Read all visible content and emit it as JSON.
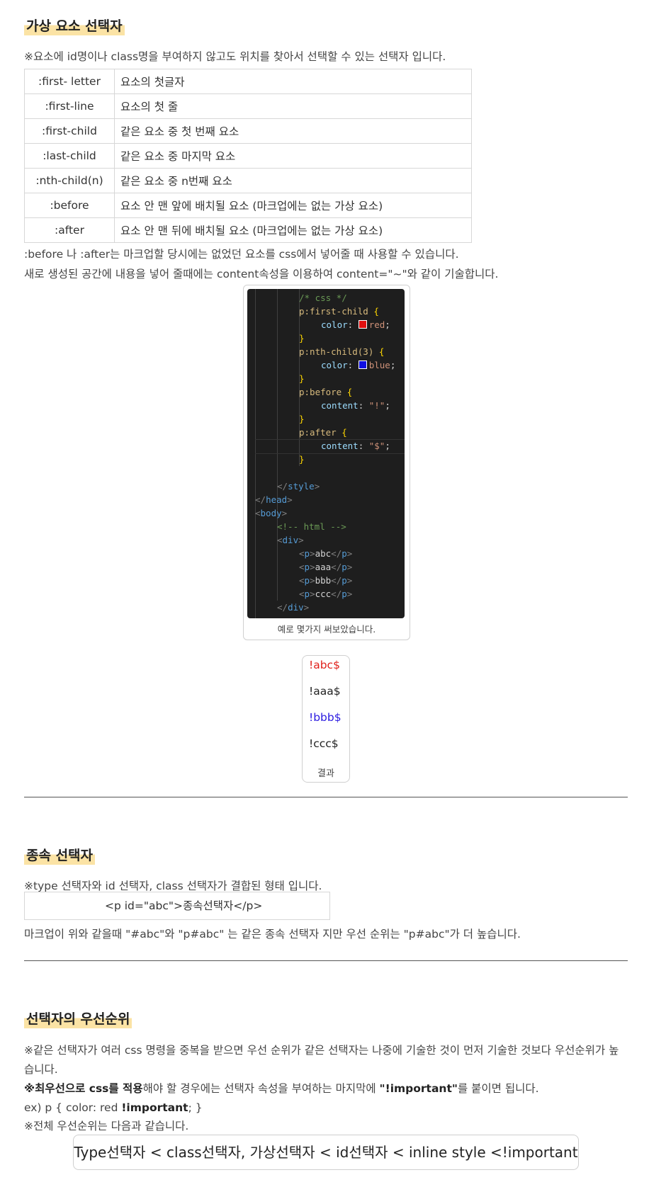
{
  "sections": {
    "pseudo": {
      "title": "가상 요소 선택자",
      "intro": "※요소에 id명이나 class명을 부여하지 않고도 위치를 찾아서 선택할 수 있는 선택자 입니다.",
      "rows": [
        {
          "key": ":first- letter",
          "desc": "요소의 첫글자"
        },
        {
          "key": ":first-line",
          "desc": "요소의 첫 줄"
        },
        {
          "key": ":first-child",
          "desc": "같은 요소 중 첫 번째 요소"
        },
        {
          "key": ":last-child",
          "desc": "같은 요소 중 마지막 요소"
        },
        {
          "key": ":nth-child(n)",
          "desc": "같은 요소 중 n번째 요소"
        },
        {
          "key": ":before",
          "desc": "요소 안 맨 앞에 배치될 요소 (마크업에는 없는 가상 요소)"
        },
        {
          "key": ":after",
          "desc": "요소 안 맨 뒤에 배치될 요소 (마크업에는 없는 가상 요소)"
        }
      ],
      "note1": ":before 나 :after는 마크업할 당시에는 없었던 요소를 css에서 넣어줄 때 사용할 수 있습니다.",
      "note2": "새로 생성된 공간에 내용을 넣어 줄때에는 content속성을 이용하여 content=\"~\"와 같이 기술합니다.",
      "code": {
        "comment_css": "/* css */",
        "sel1": "p:first-child",
        "sel2": "p:nth-child(3)",
        "sel3": "p:before",
        "sel4": "p:after",
        "brace_open": "{",
        "brace_close": "}",
        "prop_color": "color",
        "prop_content": "content",
        "colon": ": ",
        "semi": ";",
        "val_red": "red",
        "val_blue": "blue",
        "val_excl": "\"!\"",
        "val_dollar": "\"$\"",
        "swatch_red": "#e01010",
        "swatch_blue": "#1010e0",
        "style_close": "style",
        "head_close": "head",
        "body_open": "body",
        "comment_html": "<!-- html -->",
        "div": "div",
        "p": "p",
        "p_texts": [
          "abc",
          "aaa",
          "bbb",
          "ccc"
        ]
      },
      "code_caption": "예로 몇가지 써보았습니다.",
      "result": {
        "lines": [
          {
            "text": "!abc$",
            "color": "#e0201a"
          },
          {
            "text": "!aaa$",
            "color": "#222222"
          },
          {
            "text": "!bbb$",
            "color": "#2a1ae0"
          },
          {
            "text": "!ccc$",
            "color": "#222222"
          }
        ],
        "caption": "결과"
      }
    },
    "descendant": {
      "title": "종속 선택자",
      "intro": "※type 선택자와 id 선택자, class 선택자가 결합된 형태 입니다.",
      "code": "<p id=\"abc\">종속선택자</p>",
      "note": "마크업이 위와 같을때 \"#abc\"와 \"p#abc\" 는 같은 종속 선택자 지만 우선 순위는 \"p#abc\"가 더 높습니다."
    },
    "priority": {
      "title": "선택자의 우선순위",
      "line1a": "※같은 선택자가 여러 css 명령을 중복을 받으면 우선 순위가 같은 선택자는 나중에 기술한 것이 먼저 기술한 것보다 우선순위가 높",
      "line1b": "습니다.",
      "line2_bold1": "※최우선으로 css를 적용",
      "line2_mid": "해야 할 경우에는 선택자 속성을 부여하는 마지막에 ",
      "line2_bold2": "\"!important\"",
      "line2_end": "를 붙이면 됩니다.",
      "line3_a": "ex) p {  color: red ",
      "line3_bold": "!important",
      "line3_b": ";   }",
      "line4": "※전체 우선순위는 다음과 같습니다.",
      "order": "Type선택자 < class선택자, 가상선택자 < id선택자 < inline style <!important"
    }
  }
}
